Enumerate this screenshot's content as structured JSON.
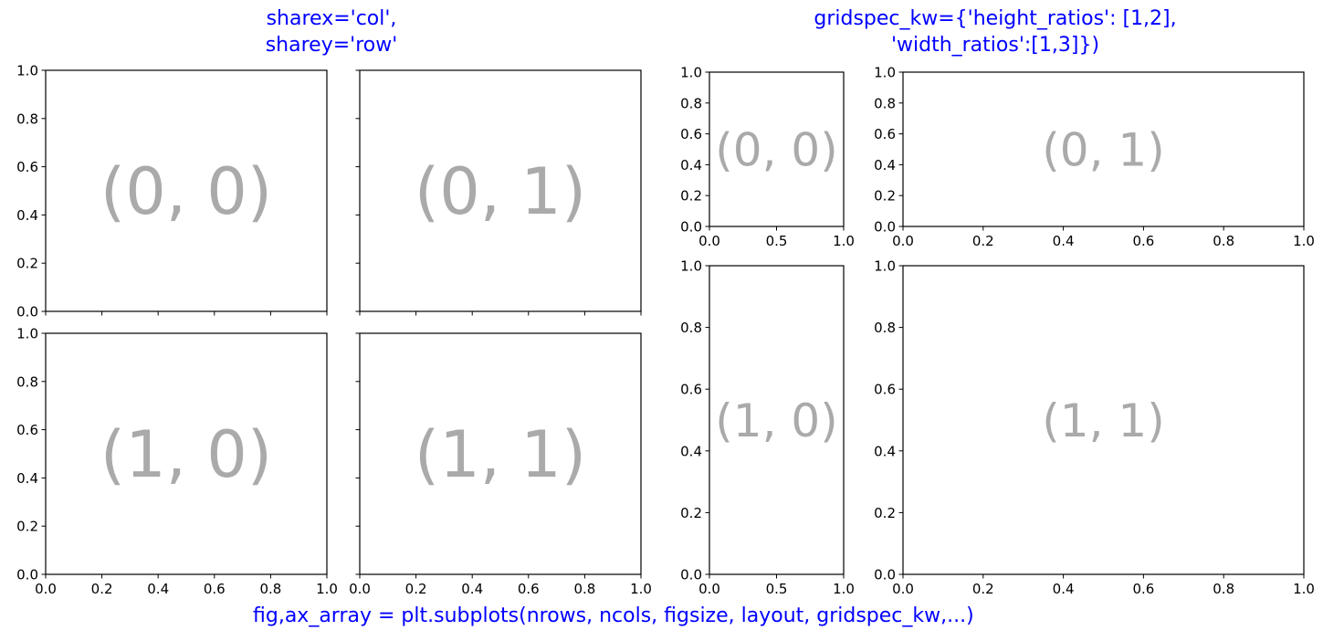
{
  "figure": {
    "left_title_line1": "sharex='col',",
    "left_title_line2": "sharey='row'",
    "right_title_line1": "gridspec_kw={'height_ratios': [1,2],",
    "right_title_line2": "'width_ratios':[1,3]})",
    "suptitle": "fig,ax_array = plt.subplots(nrows, ncols, figsize, layout, gridspec_kw,...)",
    "title_color": "#0000ff",
    "annotation_color": "#aaaaaa"
  },
  "chart_data": [
    {
      "type": "scatter",
      "panel": "left",
      "label": "(0, 0)",
      "xlim": [
        0,
        1
      ],
      "ylim": [
        0,
        1
      ],
      "xticks": [],
      "yticks": [
        "0.0",
        "0.2",
        "0.4",
        "0.6",
        "0.8",
        "1.0"
      ],
      "sharex": "col",
      "sharey": "row"
    },
    {
      "type": "scatter",
      "panel": "left",
      "label": "(0, 1)",
      "xlim": [
        0,
        1
      ],
      "ylim": [
        0,
        1
      ],
      "xticks": [],
      "yticks": [],
      "sharex": "col",
      "sharey": "row"
    },
    {
      "type": "scatter",
      "panel": "left",
      "label": "(1, 0)",
      "xlim": [
        0,
        1
      ],
      "ylim": [
        0,
        1
      ],
      "xticks": [
        "0.0",
        "0.2",
        "0.4",
        "0.6",
        "0.8",
        "1.0"
      ],
      "yticks": [
        "0.0",
        "0.2",
        "0.4",
        "0.6",
        "0.8",
        "1.0"
      ],
      "sharex": "col",
      "sharey": "row"
    },
    {
      "type": "scatter",
      "panel": "left",
      "label": "(1, 1)",
      "xlim": [
        0,
        1
      ],
      "ylim": [
        0,
        1
      ],
      "xticks": [
        "0.0",
        "0.2",
        "0.4",
        "0.6",
        "0.8",
        "1.0"
      ],
      "yticks": [],
      "sharex": "col",
      "sharey": "row"
    },
    {
      "type": "scatter",
      "panel": "right",
      "label": "(0, 0)",
      "xlim": [
        0,
        1
      ],
      "ylim": [
        0,
        1
      ],
      "xticks": [
        "0.0",
        "0.5",
        "1.0"
      ],
      "yticks": [
        "0.0",
        "0.2",
        "0.4",
        "0.6",
        "0.8",
        "1.0"
      ],
      "height_ratio": 1,
      "width_ratio": 1
    },
    {
      "type": "scatter",
      "panel": "right",
      "label": "(0, 1)",
      "xlim": [
        0,
        1
      ],
      "ylim": [
        0,
        1
      ],
      "xticks": [
        "0.0",
        "0.2",
        "0.4",
        "0.6",
        "0.8",
        "1.0"
      ],
      "yticks": [
        "0.0",
        "0.2",
        "0.4",
        "0.6",
        "0.8",
        "1.0"
      ],
      "height_ratio": 1,
      "width_ratio": 3
    },
    {
      "type": "scatter",
      "panel": "right",
      "label": "(1, 0)",
      "xlim": [
        0,
        1
      ],
      "ylim": [
        0,
        1
      ],
      "xticks": [
        "0.0",
        "0.5",
        "1.0"
      ],
      "yticks": [
        "0.0",
        "0.2",
        "0.4",
        "0.6",
        "0.8",
        "1.0"
      ],
      "height_ratio": 2,
      "width_ratio": 1
    },
    {
      "type": "scatter",
      "panel": "right",
      "label": "(1, 1)",
      "xlim": [
        0,
        1
      ],
      "ylim": [
        0,
        1
      ],
      "xticks": [
        "0.0",
        "0.2",
        "0.4",
        "0.6",
        "0.8",
        "1.0"
      ],
      "yticks": [
        "0.0",
        "0.2",
        "0.4",
        "0.6",
        "0.8",
        "1.0"
      ],
      "height_ratio": 2,
      "width_ratio": 3
    }
  ]
}
